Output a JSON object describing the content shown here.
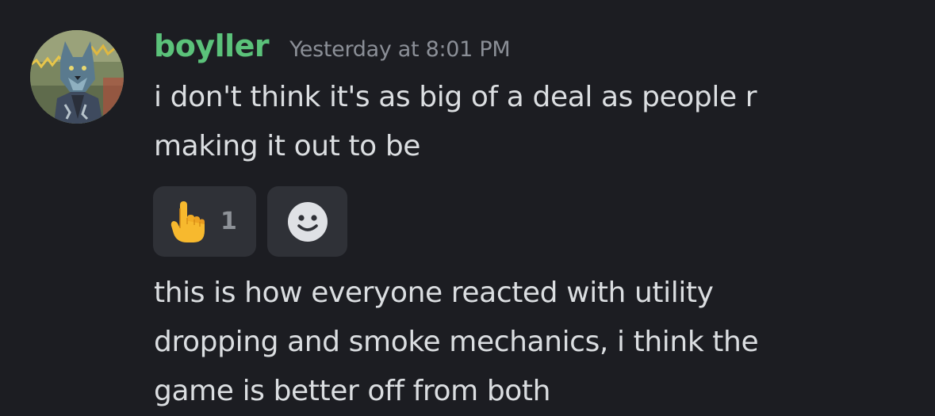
{
  "message_1": {
    "author": "boyller",
    "author_color": "#5bc27a",
    "timestamp": "Yesterday at 8:01 PM",
    "avatar_icon": "wolf-character-avatar",
    "lines": [
      "i don't think it's as big of a deal as people r",
      "making it out to be"
    ],
    "reactions": [
      {
        "emoji": "pointing-up-emoji",
        "count": "1"
      }
    ],
    "add_reaction_icon": "smiley-face-icon"
  },
  "message_2": {
    "lines": [
      "this is how everyone reacted with utility",
      "dropping and smoke mechanics, i think the",
      "game is better off from both"
    ]
  }
}
